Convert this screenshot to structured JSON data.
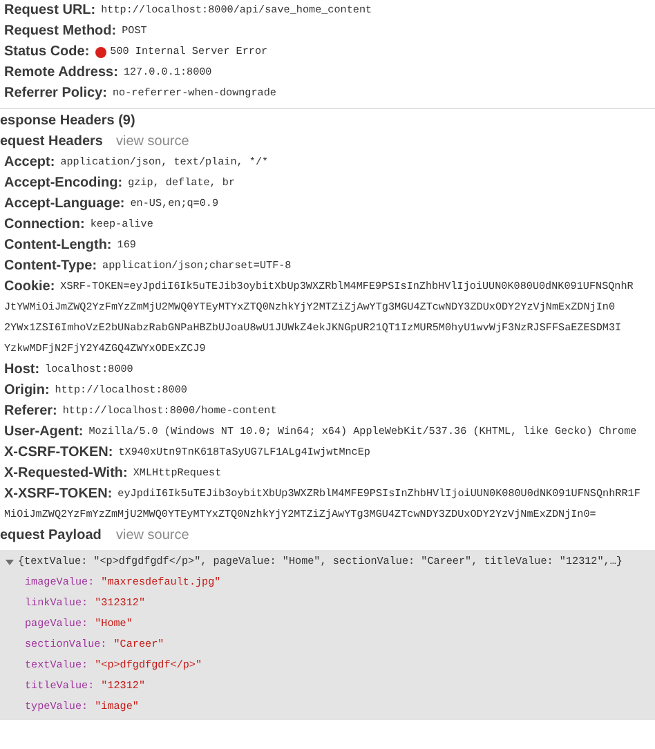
{
  "general": [
    {
      "kind": "text",
      "label": "Request URL:",
      "value": "http://localhost:8000/api/save_home_content"
    },
    {
      "kind": "text",
      "label": "Request Method:",
      "value": "POST"
    },
    {
      "kind": "status",
      "label": "Status Code:",
      "value": "500 Internal Server Error"
    },
    {
      "kind": "text",
      "label": "Remote Address:",
      "value": "127.0.0.1:8000"
    },
    {
      "kind": "text",
      "label": "Referrer Policy:",
      "value": "no-referrer-when-downgrade"
    }
  ],
  "response_headers": {
    "title": "esponse Headers (9)"
  },
  "request_headers": {
    "title": "equest Headers",
    "link": "view source",
    "rows": [
      {
        "name": "Accept:",
        "value": "application/json, text/plain, */*"
      },
      {
        "name": "Accept-Encoding:",
        "value": "gzip, deflate, br"
      },
      {
        "name": "Accept-Language:",
        "value": "en-US,en;q=0.9"
      },
      {
        "name": "Connection:",
        "value": "keep-alive"
      },
      {
        "name": "Content-Length:",
        "value": "169"
      },
      {
        "name": "Content-Type:",
        "value": "application/json;charset=UTF-8"
      },
      {
        "name": "Cookie:",
        "value": "XSRF-TOKEN=eyJpdiI6Ik5uTEJib3oybitXbUp3WXZRblM4MFE9PSIsInZhbHVlIjoiUUN0K080U0dNK091UFNSQnhR",
        "continuation": [
          "JtYWMiOiJmZWQ2YzFmYzZmMjU2MWQ0YTEyMTYxZTQ0NzhkYjY2MTZiZjAwYTg3MGU4ZTcwNDY3ZDUxODY2YzVjNmExZDNjIn0",
          "2YWx1ZSI6ImhoVzE2bUNabzRabGNPaHBZbUJoaU8wU1JUWkZ4ekJKNGpUR21QT1IzMUR5M0hyU1wvWjF3NzRJSFFSaEZESDM3I",
          "YzkwMDFjN2FjY2Y4ZGQ4ZWYxODExZCJ9"
        ]
      },
      {
        "name": "Host:",
        "value": "localhost:8000"
      },
      {
        "name": "Origin:",
        "value": "http://localhost:8000"
      },
      {
        "name": "Referer:",
        "value": "http://localhost:8000/home-content"
      },
      {
        "name": "User-Agent:",
        "value": "Mozilla/5.0 (Windows NT 10.0; Win64; x64) AppleWebKit/537.36 (KHTML, like Gecko) Chrome"
      },
      {
        "name": "X-CSRF-TOKEN:",
        "value": "tX940xUtn9TnK618TaSyUG7LF1ALg4IwjwtMncEp"
      },
      {
        "name": "X-Requested-With:",
        "value": "XMLHttpRequest"
      },
      {
        "name": "X-XSRF-TOKEN:",
        "value": "eyJpdiI6Ik5uTEJib3oybitXbUp3WXZRblM4MFE9PSIsInZhbHVlIjoiUUN0K080U0dNK091UFNSQnhRR1F",
        "continuation": [
          "MiOiJmZWQ2YzFmYzZmMjU2MWQ0YTEyMTYxZTQ0NzhkYjY2MTZiZjAwYTg3MGU4ZTcwNDY3ZDUxODY2YzVjNmExZDNjIn0="
        ]
      }
    ]
  },
  "request_payload": {
    "title": "equest Payload",
    "link": "view source",
    "expanded": true,
    "summary": "{textValue: \"<p>dfgdfgdf</p>\", pageValue: \"Home\", sectionValue: \"Career\", titleValue: \"12312\",…}",
    "items": [
      {
        "key": "imageValue:",
        "value": "\"maxresdefault.jpg\""
      },
      {
        "key": "linkValue:",
        "value": "\"312312\""
      },
      {
        "key": "pageValue:",
        "value": "\"Home\""
      },
      {
        "key": "sectionValue:",
        "value": "\"Career\""
      },
      {
        "key": "textValue:",
        "value": "\"<p>dfgdfgdf</p>\""
      },
      {
        "key": "titleValue:",
        "value": "\"12312\""
      },
      {
        "key": "typeValue:",
        "value": "\"image\""
      }
    ]
  }
}
